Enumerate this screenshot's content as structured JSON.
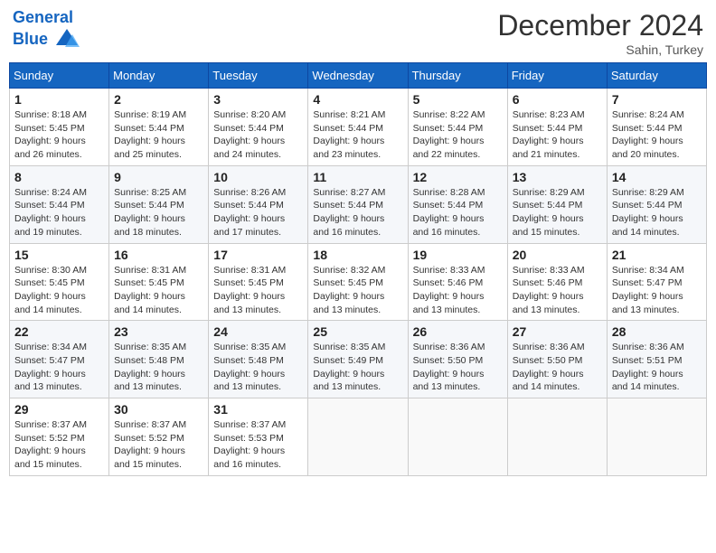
{
  "header": {
    "logo_line1": "General",
    "logo_line2": "Blue",
    "month_title": "December 2024",
    "subtitle": "Sahin, Turkey"
  },
  "weekdays": [
    "Sunday",
    "Monday",
    "Tuesday",
    "Wednesday",
    "Thursday",
    "Friday",
    "Saturday"
  ],
  "weeks": [
    [
      {
        "day": "1",
        "info": "Sunrise: 8:18 AM\nSunset: 5:45 PM\nDaylight: 9 hours and 26 minutes."
      },
      {
        "day": "2",
        "info": "Sunrise: 8:19 AM\nSunset: 5:44 PM\nDaylight: 9 hours and 25 minutes."
      },
      {
        "day": "3",
        "info": "Sunrise: 8:20 AM\nSunset: 5:44 PM\nDaylight: 9 hours and 24 minutes."
      },
      {
        "day": "4",
        "info": "Sunrise: 8:21 AM\nSunset: 5:44 PM\nDaylight: 9 hours and 23 minutes."
      },
      {
        "day": "5",
        "info": "Sunrise: 8:22 AM\nSunset: 5:44 PM\nDaylight: 9 hours and 22 minutes."
      },
      {
        "day": "6",
        "info": "Sunrise: 8:23 AM\nSunset: 5:44 PM\nDaylight: 9 hours and 21 minutes."
      },
      {
        "day": "7",
        "info": "Sunrise: 8:24 AM\nSunset: 5:44 PM\nDaylight: 9 hours and 20 minutes."
      }
    ],
    [
      {
        "day": "8",
        "info": "Sunrise: 8:24 AM\nSunset: 5:44 PM\nDaylight: 9 hours and 19 minutes."
      },
      {
        "day": "9",
        "info": "Sunrise: 8:25 AM\nSunset: 5:44 PM\nDaylight: 9 hours and 18 minutes."
      },
      {
        "day": "10",
        "info": "Sunrise: 8:26 AM\nSunset: 5:44 PM\nDaylight: 9 hours and 17 minutes."
      },
      {
        "day": "11",
        "info": "Sunrise: 8:27 AM\nSunset: 5:44 PM\nDaylight: 9 hours and 16 minutes."
      },
      {
        "day": "12",
        "info": "Sunrise: 8:28 AM\nSunset: 5:44 PM\nDaylight: 9 hours and 16 minutes."
      },
      {
        "day": "13",
        "info": "Sunrise: 8:29 AM\nSunset: 5:44 PM\nDaylight: 9 hours and 15 minutes."
      },
      {
        "day": "14",
        "info": "Sunrise: 8:29 AM\nSunset: 5:44 PM\nDaylight: 9 hours and 14 minutes."
      }
    ],
    [
      {
        "day": "15",
        "info": "Sunrise: 8:30 AM\nSunset: 5:45 PM\nDaylight: 9 hours and 14 minutes."
      },
      {
        "day": "16",
        "info": "Sunrise: 8:31 AM\nSunset: 5:45 PM\nDaylight: 9 hours and 14 minutes."
      },
      {
        "day": "17",
        "info": "Sunrise: 8:31 AM\nSunset: 5:45 PM\nDaylight: 9 hours and 13 minutes."
      },
      {
        "day": "18",
        "info": "Sunrise: 8:32 AM\nSunset: 5:45 PM\nDaylight: 9 hours and 13 minutes."
      },
      {
        "day": "19",
        "info": "Sunrise: 8:33 AM\nSunset: 5:46 PM\nDaylight: 9 hours and 13 minutes."
      },
      {
        "day": "20",
        "info": "Sunrise: 8:33 AM\nSunset: 5:46 PM\nDaylight: 9 hours and 13 minutes."
      },
      {
        "day": "21",
        "info": "Sunrise: 8:34 AM\nSunset: 5:47 PM\nDaylight: 9 hours and 13 minutes."
      }
    ],
    [
      {
        "day": "22",
        "info": "Sunrise: 8:34 AM\nSunset: 5:47 PM\nDaylight: 9 hours and 13 minutes."
      },
      {
        "day": "23",
        "info": "Sunrise: 8:35 AM\nSunset: 5:48 PM\nDaylight: 9 hours and 13 minutes."
      },
      {
        "day": "24",
        "info": "Sunrise: 8:35 AM\nSunset: 5:48 PM\nDaylight: 9 hours and 13 minutes."
      },
      {
        "day": "25",
        "info": "Sunrise: 8:35 AM\nSunset: 5:49 PM\nDaylight: 9 hours and 13 minutes."
      },
      {
        "day": "26",
        "info": "Sunrise: 8:36 AM\nSunset: 5:50 PM\nDaylight: 9 hours and 13 minutes."
      },
      {
        "day": "27",
        "info": "Sunrise: 8:36 AM\nSunset: 5:50 PM\nDaylight: 9 hours and 14 minutes."
      },
      {
        "day": "28",
        "info": "Sunrise: 8:36 AM\nSunset: 5:51 PM\nDaylight: 9 hours and 14 minutes."
      }
    ],
    [
      {
        "day": "29",
        "info": "Sunrise: 8:37 AM\nSunset: 5:52 PM\nDaylight: 9 hours and 15 minutes."
      },
      {
        "day": "30",
        "info": "Sunrise: 8:37 AM\nSunset: 5:52 PM\nDaylight: 9 hours and 15 minutes."
      },
      {
        "day": "31",
        "info": "Sunrise: 8:37 AM\nSunset: 5:53 PM\nDaylight: 9 hours and 16 minutes."
      },
      null,
      null,
      null,
      null
    ]
  ]
}
